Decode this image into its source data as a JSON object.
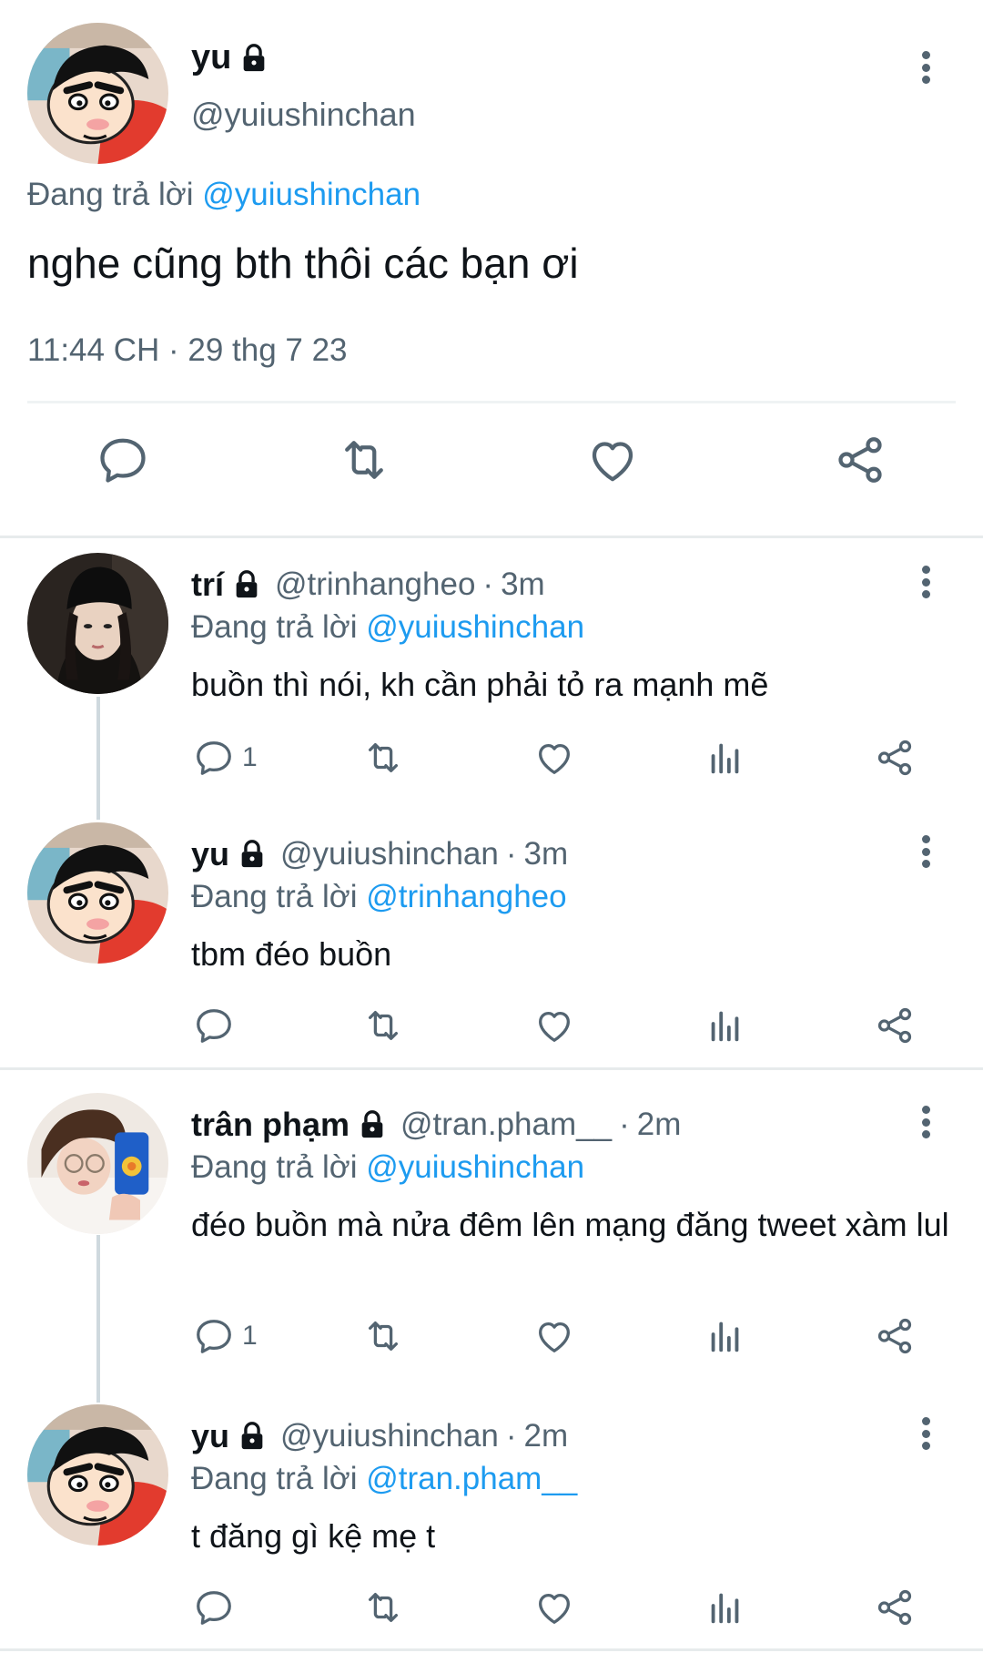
{
  "colors": {
    "accent": "#1d9bf0",
    "muted_text": "#536471",
    "icon": "#536471",
    "divider": "#eff3f4"
  },
  "main_tweet": {
    "name": "yu",
    "handle": "@yuiushinchan",
    "replying_prefix": "Đang trả lời",
    "replying_to": "@yuiushinchan",
    "text": "nghe cũng bth thôi các bạn ơi",
    "timestamp": "11:44 CH · 29 thg 7 23",
    "icons": [
      "reply-icon",
      "retweet-icon",
      "like-icon",
      "share-icon"
    ]
  },
  "replies": [
    {
      "name": "trí",
      "handle": "@trinhangheo",
      "time": "3m",
      "replying_prefix": "Đang trả lời",
      "replying_to": "@yuiushinchan",
      "text": "buồn thì nói, kh cần phải tỏ ra mạnh mẽ",
      "reply_count": "1"
    },
    {
      "name": "yu",
      "handle": "@yuiushinchan",
      "time": "3m",
      "replying_prefix": "Đang trả lời",
      "replying_to": "@trinhangheo",
      "text": "tbm đéo buồn",
      "reply_count": ""
    },
    {
      "name": "trân phạm",
      "handle": "@tran.pham__",
      "time": "2m",
      "replying_prefix": "Đang trả lời",
      "replying_to": "@yuiushinchan",
      "text": "đéo buồn mà nửa đêm lên mạng đăng tweet xàm lul",
      "reply_count": "1"
    },
    {
      "name": "yu",
      "handle": "@yuiushinchan",
      "time": "2m",
      "replying_prefix": "Đang trả lời",
      "replying_to": "@tran.pham__",
      "text": "t đăng gì kệ mẹ t",
      "reply_count": ""
    }
  ],
  "time_separator": "·"
}
